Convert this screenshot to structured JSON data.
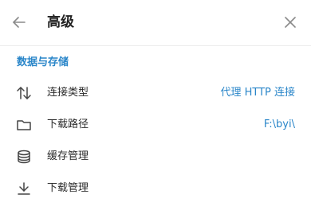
{
  "colors": {
    "accent": "#2a86c9",
    "icon": "#555555",
    "divider": "#ececec"
  },
  "header": {
    "title": "高级",
    "back_icon": "arrow-left-icon",
    "close_icon": "close-icon"
  },
  "section": {
    "title": "数据与存储"
  },
  "rows": [
    {
      "icon": "transfer-arrows-icon",
      "label": "连接类型",
      "value": "代理 HTTP 连接"
    },
    {
      "icon": "folder-icon",
      "label": "下载路径",
      "value": "F:\\byi\\"
    },
    {
      "icon": "database-icon",
      "label": "缓存管理",
      "value": ""
    },
    {
      "icon": "download-icon",
      "label": "下载管理",
      "value": ""
    }
  ]
}
